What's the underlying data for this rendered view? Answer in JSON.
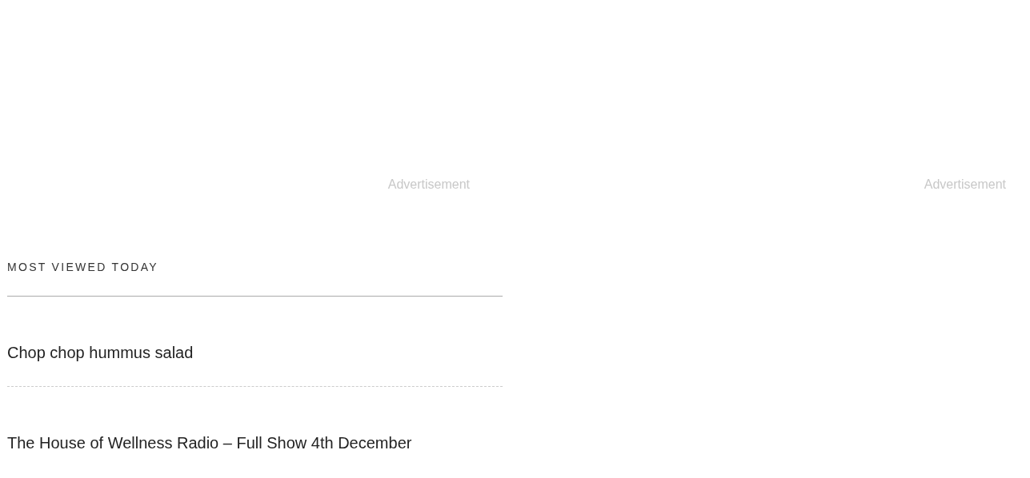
{
  "ads": [
    {
      "label": "Advertisement"
    },
    {
      "label": "Advertisement"
    }
  ],
  "most_viewed": {
    "heading": "MOST VIEWED TODAY",
    "items": [
      {
        "title": "Chop chop hummus salad"
      },
      {
        "title": "The House of Wellness Radio – Full Show 4th December"
      }
    ]
  }
}
